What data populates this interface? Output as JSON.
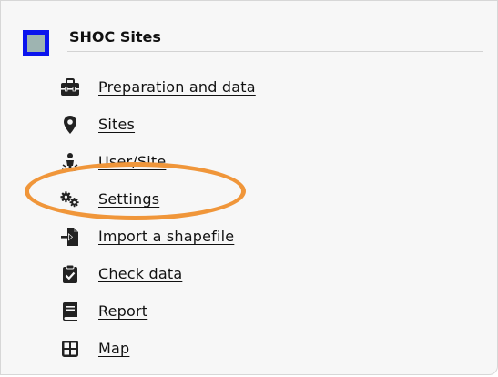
{
  "module": {
    "title": "SHOC Sites",
    "logo_color": "#9eb4b1",
    "logo_border_color": "#0b14ee"
  },
  "menu": {
    "items": [
      {
        "label": "Preparation and data",
        "icon": "toolbox-icon"
      },
      {
        "label": "Sites",
        "icon": "map-pin-icon"
      },
      {
        "label": "User/Site",
        "icon": "user-site-icon"
      },
      {
        "label": "Settings",
        "icon": "gears-icon"
      },
      {
        "label": "Import a shapefile",
        "icon": "file-import-icon"
      },
      {
        "label": "Check data",
        "icon": "clipboard-check-icon"
      },
      {
        "label": "Report",
        "icon": "book-icon"
      },
      {
        "label": "Map",
        "icon": "grid-map-icon"
      }
    ]
  },
  "annotation": {
    "highlight_color": "#f0963a"
  }
}
